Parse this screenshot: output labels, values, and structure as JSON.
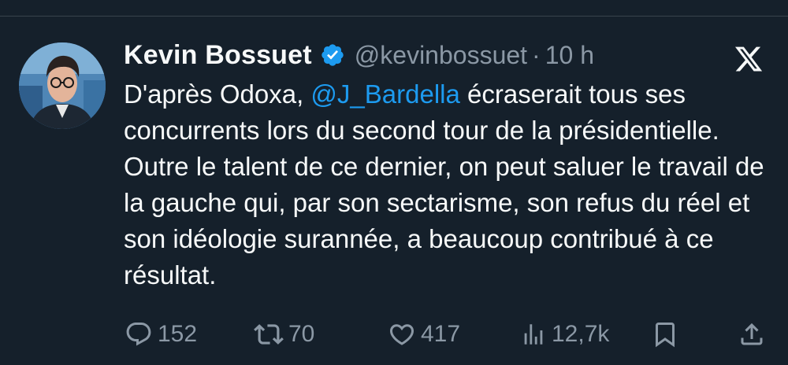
{
  "tweet": {
    "display_name": "Kevin Bossuet",
    "handle": "@kevinbossuet",
    "separator": "·",
    "time": "10 h",
    "text_before": "D'après Odoxa, ",
    "mention": "@J_Bardella",
    "text_after": " écraserait tous ses concurrents lors du second tour de la présidentielle. Outre le talent de ce dernier, on peut saluer le travail de la gauche qui, par son sectarisme, son refus du réel et son idéologie surannée, a beaucoup contribué à ce résultat."
  },
  "stats": {
    "replies": "152",
    "reposts": "70",
    "likes": "417",
    "views": "12,7k"
  },
  "icons": {
    "verified": "verified-badge-icon",
    "platform": "x-logo-icon",
    "reply": "reply-icon",
    "repost": "repost-icon",
    "like": "like-icon",
    "views": "views-icon",
    "bookmark": "bookmark-icon",
    "share": "share-icon"
  },
  "colors": {
    "background": "#15202b",
    "primary_text": "#f7f9f9",
    "secondary_text": "#8b98a5",
    "accent": "#1d9bf0"
  }
}
